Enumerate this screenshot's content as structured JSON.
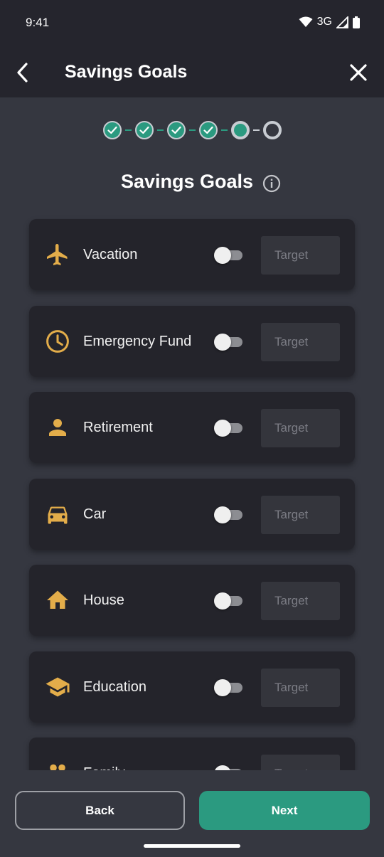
{
  "status_bar": {
    "time": "9:41",
    "network": "3G",
    "icons": [
      "wifi-icon",
      "signal-icon",
      "battery-icon"
    ]
  },
  "app_bar": {
    "title": "Savings Goals",
    "back_icon": "chevron-left-icon",
    "close_icon": "close-icon"
  },
  "stepper": {
    "total_steps": 6,
    "completed_steps": 4,
    "current_step": 5
  },
  "section": {
    "title": "Savings Goals",
    "info_icon": "info-icon"
  },
  "goals": [
    {
      "label": "Vacation",
      "icon": "airplane-icon",
      "enabled": false,
      "placeholder": "Target"
    },
    {
      "label": "Emergency Fund",
      "icon": "clock-icon",
      "enabled": false,
      "placeholder": "Target"
    },
    {
      "label": "Retirement",
      "icon": "person-icon",
      "enabled": false,
      "placeholder": "Target"
    },
    {
      "label": "Car",
      "icon": "car-icon",
      "enabled": false,
      "placeholder": "Target"
    },
    {
      "label": "House",
      "icon": "house-icon",
      "enabled": false,
      "placeholder": "Target"
    },
    {
      "label": "Education",
      "icon": "graduation-cap-icon",
      "enabled": false,
      "placeholder": "Target"
    },
    {
      "label": "Family",
      "icon": "family-icon",
      "enabled": false,
      "placeholder": "Target"
    }
  ],
  "footer": {
    "back_label": "Back",
    "next_label": "Next"
  },
  "colors": {
    "accent": "#2b9a80",
    "icon_gold": "#e3ad4a",
    "card_bg": "#24242b",
    "page_bg": "#353740",
    "bar_bg": "#25252d"
  }
}
